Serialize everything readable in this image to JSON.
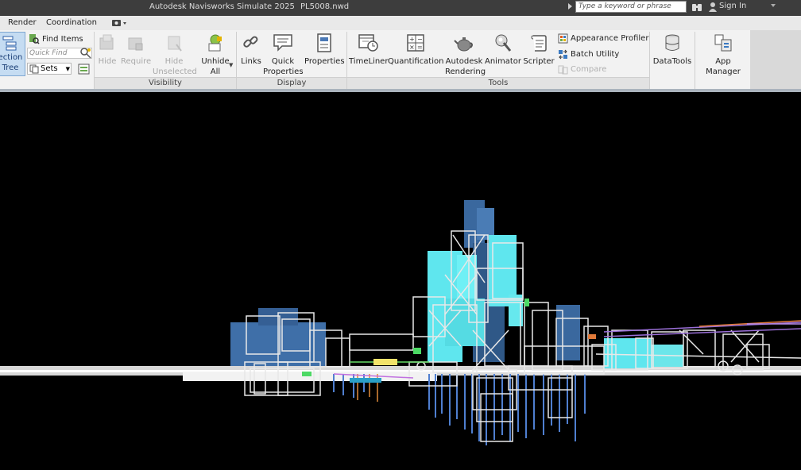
{
  "titlebar": {
    "app_title": "Autodesk Navisworks Simulate 2025",
    "file_name": "PL5008.nwd",
    "search_placeholder": "Type a keyword or phrase",
    "sign_in": "Sign In"
  },
  "tabs": [
    {
      "label": "Render"
    },
    {
      "label": "Coordination"
    }
  ],
  "ribbon": {
    "select_search": {
      "selection_tree_line1": "ection",
      "selection_tree_line2": "Tree",
      "find_items": "Find Items",
      "quick_find_placeholder": "Quick Find",
      "sets": "Sets"
    },
    "visibility": {
      "panel_label": "Visibility",
      "hide": "Hide",
      "require": "Require",
      "hide_unselected_1": "Hide",
      "hide_unselected_2": "Unselected",
      "unhide_all_1": "Unhide",
      "unhide_all_2": "All"
    },
    "display": {
      "panel_label": "Display",
      "links": "Links",
      "quick_properties_1": "Quick",
      "quick_properties_2": "Properties",
      "properties": "Properties"
    },
    "tools": {
      "panel_label": "Tools",
      "timeliner": "TimeLiner",
      "quantification": "Quantification",
      "autodesk_rendering_1": "Autodesk",
      "autodesk_rendering_2": "Rendering",
      "animator": "Animator",
      "scripter": "Scripter",
      "appearance_profiler": "Appearance Profiler",
      "batch_utility": "Batch Utility",
      "compare": "Compare"
    },
    "datatools": "DataTools",
    "app_manager": "App Manager"
  },
  "colors": {
    "viewport_bg": "#000000",
    "wireframe": "#e8e8e8",
    "cyan": "#5fe6ee",
    "steel_blue": "#3f6fa8",
    "ribbon_bg": "#f2f2f2"
  }
}
